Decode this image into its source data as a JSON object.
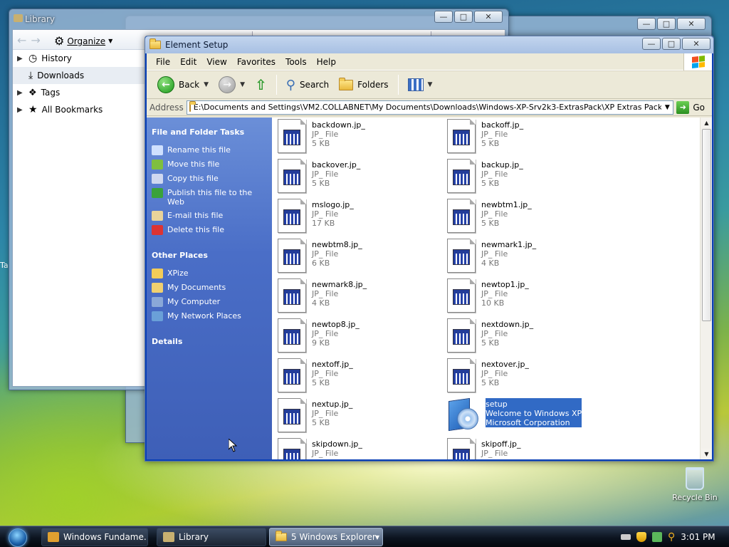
{
  "desktop": {
    "recycle_bin_label": "Recycle Bin",
    "clipped_text": "Ta"
  },
  "library_window": {
    "title": "Library",
    "organize_label": "Organize",
    "tree": [
      {
        "label": "History",
        "icon": "clock-icon",
        "has_arrow": true
      },
      {
        "label": "Downloads",
        "icon": "download-icon",
        "has_arrow": false,
        "selected": true
      },
      {
        "label": "Tags",
        "icon": "tag-icon",
        "has_arrow": true
      },
      {
        "label": "All Bookmarks",
        "icon": "star-icon",
        "has_arrow": true
      }
    ]
  },
  "explorer": {
    "title": "Element Setup",
    "menu": [
      "File",
      "Edit",
      "View",
      "Favorites",
      "Tools",
      "Help"
    ],
    "toolbar": {
      "back_label": "Back",
      "search_label": "Search",
      "folders_label": "Folders"
    },
    "address": {
      "label": "Address",
      "value": "E:\\Documents and Settings\\VM2.COLLABNET\\My Documents\\Downloads\\Windows-XP-Srv2k3-ExtrasPack\\XP Extras Pack\\Shell\\",
      "go_label": "Go"
    },
    "tasks": {
      "file_folder_title": "File and Folder Tasks",
      "file_folder_items": [
        {
          "label": "Rename this file",
          "color": "#cfe0ff"
        },
        {
          "label": "Move this file",
          "color": "#7fbf3f"
        },
        {
          "label": "Copy this file",
          "color": "#d0d8f0"
        },
        {
          "label": "Publish this file to the Web",
          "color": "#3aa23a"
        },
        {
          "label": "E-mail this file",
          "color": "#e9d39a"
        },
        {
          "label": "Delete this file",
          "color": "#d33"
        }
      ],
      "other_places_title": "Other Places",
      "other_places_items": [
        {
          "label": "XPize",
          "color": "#f3cc58"
        },
        {
          "label": "My Documents",
          "color": "#f0d070"
        },
        {
          "label": "My Computer",
          "color": "#8aa8d8"
        },
        {
          "label": "My Network Places",
          "color": "#6aa0d8"
        }
      ],
      "details_title": "Details"
    },
    "files": [
      {
        "name": "backdown.jp_",
        "type": "JP_ File",
        "size": "5 KB"
      },
      {
        "name": "backoff.jp_",
        "type": "JP_ File",
        "size": "5 KB"
      },
      {
        "name": "backover.jp_",
        "type": "JP_ File",
        "size": "5 KB"
      },
      {
        "name": "backup.jp_",
        "type": "JP_ File",
        "size": "5 KB"
      },
      {
        "name": "mslogo.jp_",
        "type": "JP_ File",
        "size": "17 KB"
      },
      {
        "name": "newbtm1.jp_",
        "type": "JP_ File",
        "size": "5 KB"
      },
      {
        "name": "newbtm8.jp_",
        "type": "JP_ File",
        "size": "6 KB"
      },
      {
        "name": "newmark1.jp_",
        "type": "JP_ File",
        "size": "4 KB"
      },
      {
        "name": "newmark8.jp_",
        "type": "JP_ File",
        "size": "4 KB"
      },
      {
        "name": "newtop1.jp_",
        "type": "JP_ File",
        "size": "10 KB"
      },
      {
        "name": "newtop8.jp_",
        "type": "JP_ File",
        "size": "9 KB"
      },
      {
        "name": "nextdown.jp_",
        "type": "JP_ File",
        "size": "5 KB"
      },
      {
        "name": "nextoff.jp_",
        "type": "JP_ File",
        "size": "5 KB"
      },
      {
        "name": "nextover.jp_",
        "type": "JP_ File",
        "size": "5 KB"
      },
      {
        "name": "nextup.jp_",
        "type": "JP_ File",
        "size": "5 KB"
      },
      {
        "name": "setup",
        "type": "Welcome to Windows XP",
        "size": "Microsoft Corporation",
        "selected": true,
        "icon": "setup-cd-icon"
      },
      {
        "name": "skipdown.jp_",
        "type": "JP_ File",
        "size": ""
      },
      {
        "name": "skipoff.jp_",
        "type": "JP_ File",
        "size": ""
      }
    ]
  },
  "taskbar": {
    "buttons": [
      {
        "label": "Windows Fundame...",
        "color": "#e0a030"
      },
      {
        "label": "Library",
        "color": "#c8b070"
      },
      {
        "label": "5 Windows Explorer",
        "color": "#f3cc58",
        "active": true
      }
    ],
    "clock": "3:01 PM"
  }
}
